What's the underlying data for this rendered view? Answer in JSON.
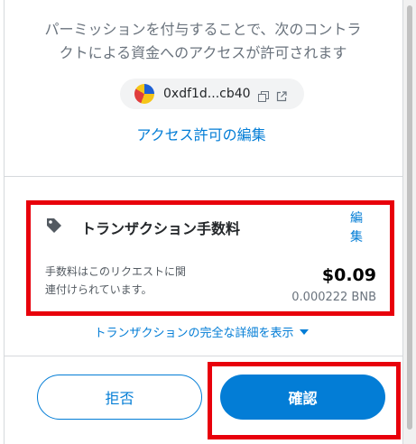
{
  "permission": {
    "line1": "パーミッションを付与することで、次のコントラ",
    "line2": "クトによる資金へのアクセスが許可されます"
  },
  "contract": {
    "address": "0xdf1d...cb40",
    "copy_icon": "copy-icon",
    "external_icon": "external-link-icon"
  },
  "edit_access_label": "アクセス許可の編集",
  "fee": {
    "icon": "tag-icon",
    "title": "トランザクション手数料",
    "edit_label_1": "編",
    "edit_label_2": "集",
    "description_1": "手数料はこのリクエストに関",
    "description_2": "連付けられています。",
    "amount": "$0.09",
    "native_amount": "0.000222 BNB"
  },
  "details_link_label": "トランザクションの完全な詳細を表示",
  "buttons": {
    "reject_label": "拒否",
    "confirm_label": "確認"
  },
  "colors": {
    "accent": "#037dd6",
    "highlight": "#e8000b"
  }
}
